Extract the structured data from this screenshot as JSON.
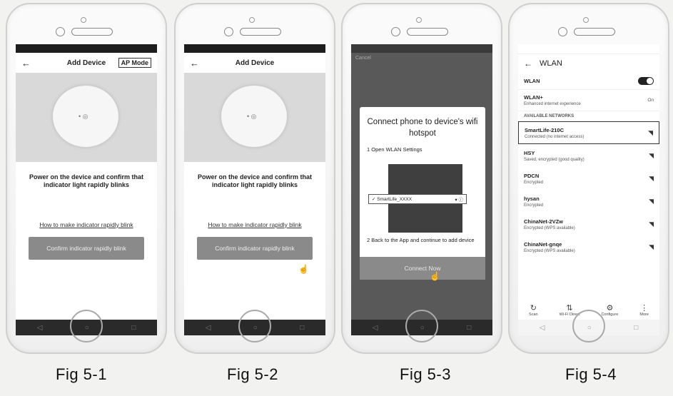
{
  "phone1": {
    "title": "Add Device",
    "ap_mode": "AP Mode",
    "instruction": "Power on the device and confirm that indicator light rapidly blinks",
    "link": "How to make indicator rapidly blink",
    "button": "Confirm indicator rapidly blink"
  },
  "phone2": {
    "title": "Add Device",
    "instruction": "Power on the device and confirm that indicator light rapidly blinks",
    "link": "How to make indicator rapidly blink",
    "button": "Confirm indicator rapidly blink"
  },
  "phone3": {
    "top_label": "Cancel",
    "dialog_title": "Connect phone to device's wifi hotspot",
    "step1": "1 Open WLAN Settings",
    "network": "SmartLife_XXXX",
    "step2": "2 Back to the App and continue to add device",
    "button": "Connect Now"
  },
  "phone4": {
    "header": "WLAN",
    "wlan_label": "WLAN",
    "wlan_plus": "WLAN+",
    "wlan_plus_sub": "Enhanced internet experience",
    "wlan_plus_value": "On",
    "section": "AVAILABLE NETWORKS",
    "networks": [
      {
        "name": "SmartLife-210C",
        "status": "Connected (no internet access)"
      },
      {
        "name": "HSY",
        "status": "Saved, encrypted (good quality)"
      },
      {
        "name": "PDCN",
        "status": "Encrypted"
      },
      {
        "name": "hysan",
        "status": "Encrypted"
      },
      {
        "name": "ChinaNet-2VZw",
        "status": "Encrypted (WPS available)"
      },
      {
        "name": "ChinaNet-gnqe",
        "status": "Encrypted (WPS available)"
      }
    ],
    "tools": [
      "Scan",
      "Wi-Fi Direct",
      "Configure",
      "More"
    ]
  },
  "captions": [
    "Fig 5-1",
    "Fig 5-2",
    "Fig 5-3",
    "Fig 5-4"
  ]
}
